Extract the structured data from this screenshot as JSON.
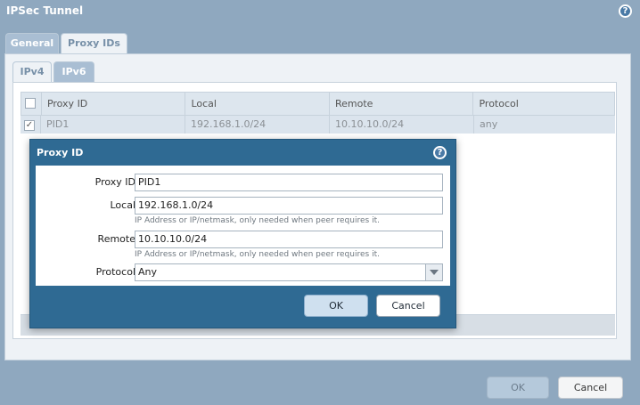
{
  "window": {
    "title": "IPSec Tunnel"
  },
  "tabs": [
    {
      "label": "General"
    },
    {
      "label": "Proxy IDs"
    }
  ],
  "subtabs": [
    {
      "label": "IPv4"
    },
    {
      "label": "IPv6"
    }
  ],
  "grid": {
    "columns": [
      "Proxy ID",
      "Local",
      "Remote",
      "Protocol"
    ],
    "rows": [
      {
        "checked": "✓",
        "proxy_id": "PID1",
        "local": "192.168.1.0/24",
        "remote": "10.10.10.0/24",
        "protocol": "any"
      }
    ]
  },
  "dialog": {
    "title": "Proxy ID",
    "proxy_id": {
      "label": "Proxy ID",
      "value": "PID1"
    },
    "local": {
      "label": "Local",
      "value": "192.168.1.0/24",
      "hint": "IP Address or IP/netmask, only needed when peer requires it."
    },
    "remote": {
      "label": "Remote",
      "value": "10.10.10.0/24",
      "hint": "IP Address or IP/netmask, only needed when peer requires it."
    },
    "protocol": {
      "label": "Protocol",
      "value": "Any"
    },
    "ok_label": "OK",
    "cancel_label": "Cancel"
  },
  "footer": {
    "ok_label": "OK",
    "cancel_label": "Cancel"
  },
  "colors": {
    "title_bar": "#8fa8bf",
    "dialog_header": "#2f6a93",
    "row_selected": "#dbe4ed"
  }
}
